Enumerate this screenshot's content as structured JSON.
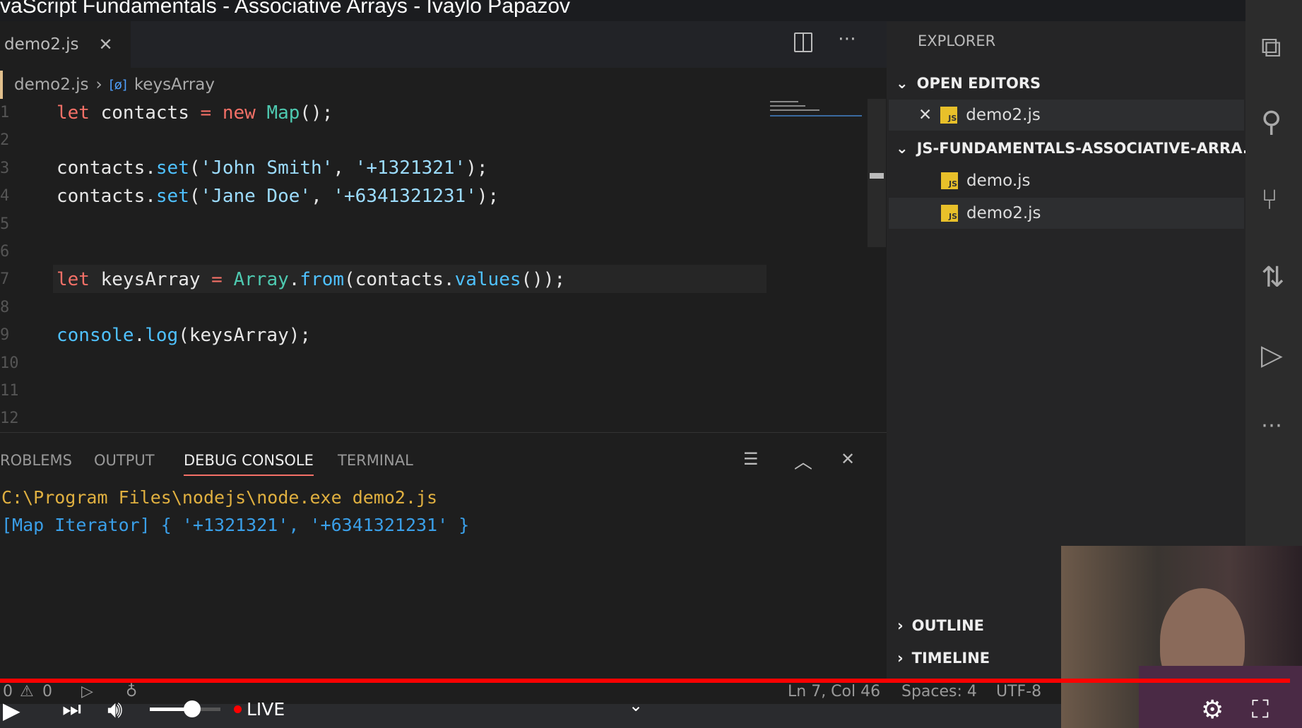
{
  "video": {
    "title": "vaScript Fundamentals - Associative Arrays - Ivaylo Papazov"
  },
  "editor": {
    "tab_label": "demo2.js",
    "breadcrumb_file": "demo2.js",
    "breadcrumb_symbol": "keysArray",
    "line_numbers": [
      "1",
      "2",
      "3",
      "4",
      "5",
      "6",
      "7",
      "8",
      "9",
      "10",
      "11",
      "12"
    ],
    "lines": [
      [
        [
          "kw",
          "let "
        ],
        [
          "id",
          "contacts "
        ],
        [
          "kw",
          "= new "
        ],
        [
          "cls",
          "Map"
        ],
        [
          "id",
          "();"
        ]
      ],
      [],
      [
        [
          "id",
          "contacts."
        ],
        [
          "fn",
          "set"
        ],
        [
          "id",
          "("
        ],
        [
          "str",
          "'John Smith'"
        ],
        [
          "id",
          ", "
        ],
        [
          "str",
          "'+1321321'"
        ],
        [
          "id",
          ");"
        ]
      ],
      [
        [
          "id",
          "contacts."
        ],
        [
          "fn",
          "set"
        ],
        [
          "id",
          "("
        ],
        [
          "str",
          "'Jane Doe'"
        ],
        [
          "id",
          ", "
        ],
        [
          "str",
          "'+6341321231'"
        ],
        [
          "id",
          ");"
        ]
      ],
      [],
      [],
      [
        [
          "kw",
          "let "
        ],
        [
          "id",
          "keysArray "
        ],
        [
          "kw",
          "= "
        ],
        [
          "cls",
          "Array"
        ],
        [
          "id",
          "."
        ],
        [
          "fn",
          "from"
        ],
        [
          "id",
          "(contacts."
        ],
        [
          "fn",
          "values"
        ],
        [
          "id",
          "());"
        ]
      ],
      [],
      [
        [
          "fn",
          "console"
        ],
        [
          "id",
          "."
        ],
        [
          "fn",
          "log"
        ],
        [
          "id",
          "(keysArray);"
        ]
      ],
      [],
      [],
      []
    ]
  },
  "panel": {
    "tabs": [
      "ROBLEMS",
      "OUTPUT",
      "DEBUG CONSOLE",
      "TERMINAL"
    ],
    "active": "DEBUG CONSOLE",
    "output": [
      "C:\\Program Files\\nodejs\\node.exe demo2.js",
      "[Map Iterator] { '+1321321', '+6341321231' }"
    ]
  },
  "explorer": {
    "title": "EXPLORER",
    "open_editors": "OPEN EDITORS",
    "open_file": "demo2.js",
    "folder": "JS-FUNDAMENTALS-ASSOCIATIVE-ARRA...",
    "files": [
      "demo.js",
      "demo2.js"
    ],
    "outline": "OUTLINE",
    "timeline": "TIMELINE",
    "js_badge": "JS"
  },
  "status": {
    "errors": "0",
    "warnings": "0",
    "position": "Ln 7, Col 46",
    "spaces": "Spaces: 4",
    "encoding": "UTF-8"
  },
  "player": {
    "live": "LIVE",
    "volume": 0.6,
    "accent": "#ff0000"
  }
}
